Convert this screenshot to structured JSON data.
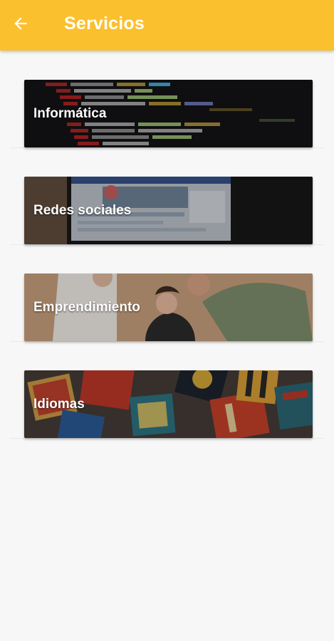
{
  "header": {
    "title": "Servicios",
    "back_icon": "arrow-left-icon",
    "background": "#fbc02d"
  },
  "services": [
    {
      "label": "Informática"
    },
    {
      "label": "Redes sociales"
    },
    {
      "label": "Emprendimiento"
    },
    {
      "label": "Idiomas"
    }
  ]
}
